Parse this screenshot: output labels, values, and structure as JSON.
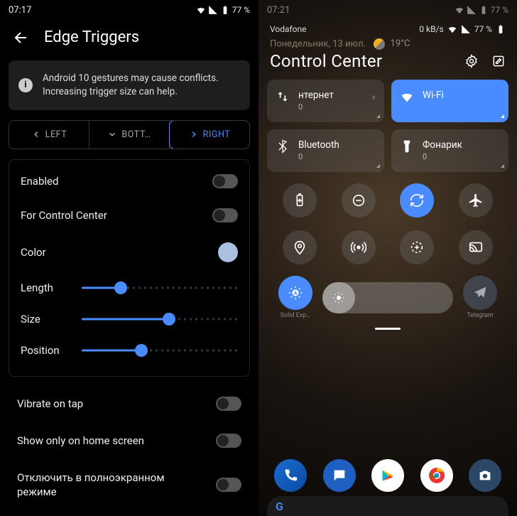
{
  "left": {
    "status": {
      "time": "07:17",
      "battery": "77 %"
    },
    "title": "Edge Triggers",
    "warning": "Android 10 gestures may cause conflicts. Increasing trigger size can help.",
    "tabs": {
      "left": "LEFT",
      "bottom": "BOTT…",
      "right": "RIGHT",
      "active": "right"
    },
    "rows": {
      "enabled": "Enabled",
      "cc": "For Control Center",
      "color": "Color"
    },
    "sliders": {
      "length": {
        "label": "Length",
        "pct": 25
      },
      "size": {
        "label": "Size",
        "pct": 56
      },
      "position": {
        "label": "Position",
        "pct": 38
      }
    },
    "below": {
      "vibrate": "Vibrate on tap",
      "home": "Show only on home screen",
      "fullscreen": "Отключить в полноэкранном режиме"
    }
  },
  "right": {
    "status": {
      "time": "07:21",
      "battery": "77 %"
    },
    "carrier": "Vodafone",
    "netspeed": "0 kB/s",
    "date": "Понедельник, 13 июл.",
    "temp": "19°C",
    "title": "Control Center",
    "tiles": {
      "internet": {
        "label": "нтернет",
        "sub": "0"
      },
      "wifi": {
        "label": "Wi-Fi",
        "sub": " "
      },
      "bt": {
        "label": "Bluetooth",
        "sub": "0"
      },
      "flash": {
        "label": "Фонарик",
        "sub": "0"
      }
    },
    "applabels": {
      "solid": "Solid Exp…",
      "telegram": "Telegram"
    }
  }
}
